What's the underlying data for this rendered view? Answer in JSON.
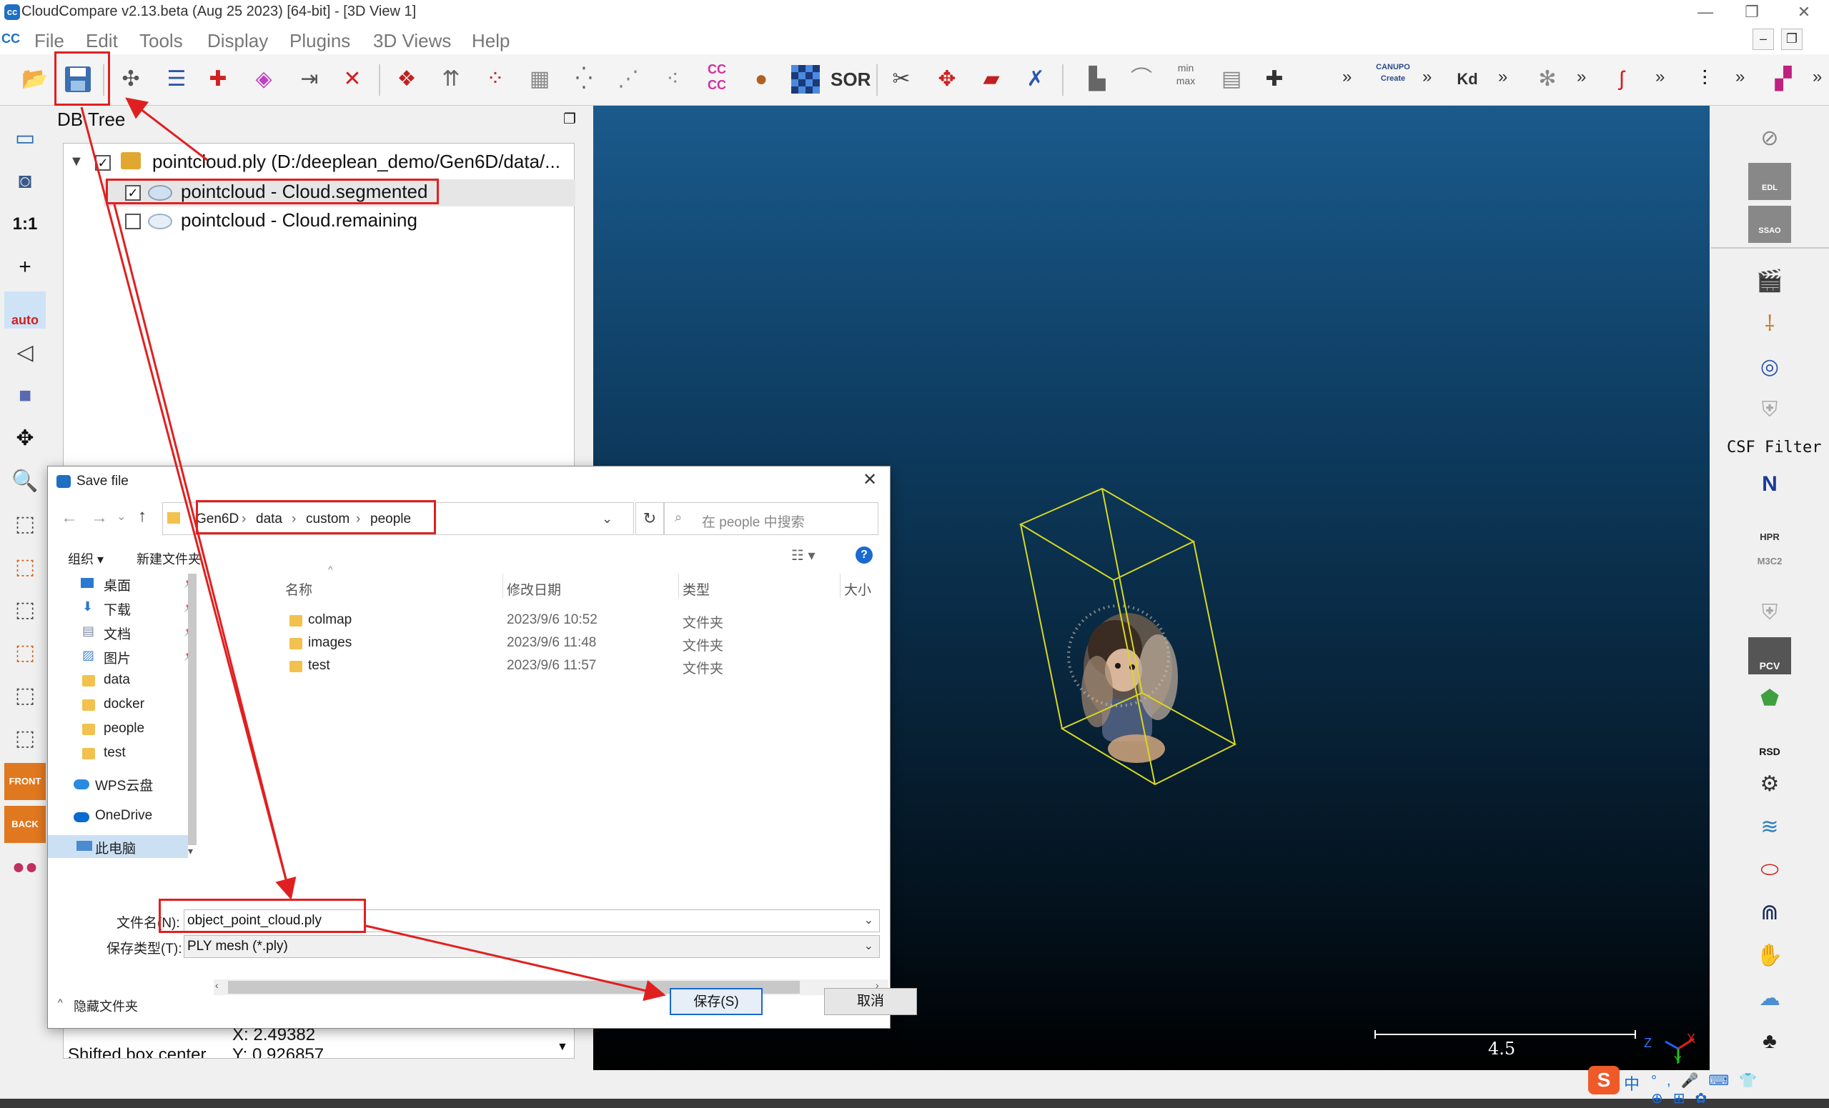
{
  "window": {
    "title": "CloudCompare v2.13.beta (Aug 25 2023) [64-bit] - [3D View 1]",
    "minimize": "—",
    "restore": "❐",
    "close": "✕",
    "mdi_min": "–",
    "mdi_restore": "❐"
  },
  "menu": [
    "File",
    "Edit",
    "Tools",
    "Display",
    "Plugins",
    "3D Views",
    "Help"
  ],
  "toolbar": {
    "icons": [
      "open-icon",
      "save-icon",
      "sample-icon",
      "list-icon",
      "crosshair-icon",
      "color-icon",
      "translate-icon",
      "delete-icon",
      "merge-icon",
      "normals-icon",
      "sample-points-icon",
      "mesh-icon",
      "subsample-icon",
      "scatter-icon",
      "scatter2-icon",
      "scatter3-icon"
    ],
    "cc_label": "CC\nCC",
    "sor_label": "SOR",
    "canupo_label": "CANUPO\nCreate",
    "kd_label": "Kd",
    "minmax_label": "min\nmax"
  },
  "left_tools": {
    "scale_label": "1:1",
    "auto_label": "auto",
    "front_label": "FRONT",
    "back_label": "BACK"
  },
  "db_tree": {
    "title": "DB Tree",
    "root": {
      "label": "pointcloud.ply (D:/deeplean_demo/Gen6D/data/...",
      "checked": true
    },
    "children": [
      {
        "label": "pointcloud - Cloud.segmented",
        "checked": true,
        "selected": true
      },
      {
        "label": "pointcloud - Cloud.remaining",
        "checked": false,
        "selected": false
      }
    ],
    "props": {
      "x_label": "X: 2.49382",
      "shifted_label": "Shifted box center",
      "y_label": "Y: 0.926857"
    }
  },
  "right_tools": {
    "edl_label": "EDL",
    "ssao_label": "SSAO",
    "csf_label": "CSF Filter",
    "north_label": "N",
    "hpr_label": "HPR",
    "m3c2_label": "M3C2",
    "pcv_label": "PCV",
    "rsd_label": "RSD"
  },
  "view3d": {
    "scale_value": "4.5",
    "axis_x": "X",
    "axis_y": "Y",
    "axis_z": "Z"
  },
  "dialog": {
    "title": "Save file",
    "breadcrumb": [
      "Gen6D",
      "data",
      "custom",
      "people"
    ],
    "search_placeholder": "在 people 中搜索",
    "organize": "组织 ▾",
    "new_folder": "新建文件夹",
    "nav": [
      {
        "label": "桌面",
        "pinned": true
      },
      {
        "label": "下载",
        "pinned": true
      },
      {
        "label": "文档",
        "pinned": true
      },
      {
        "label": "图片",
        "pinned": true
      },
      {
        "label": "data",
        "pinned": false
      },
      {
        "label": "docker",
        "pinned": false
      },
      {
        "label": "people",
        "pinned": false
      },
      {
        "label": "test",
        "pinned": false
      },
      {
        "label": "WPS云盘",
        "pinned": false
      },
      {
        "label": "OneDrive",
        "pinned": false
      },
      {
        "label": "此电脑",
        "pinned": false
      }
    ],
    "columns": [
      "名称",
      "修改日期",
      "类型",
      "大小"
    ],
    "files": [
      {
        "name": "colmap",
        "date": "2023/9/6 10:52",
        "type": "文件夹"
      },
      {
        "name": "images",
        "date": "2023/9/6 11:48",
        "type": "文件夹"
      },
      {
        "name": "test",
        "date": "2023/9/6 11:57",
        "type": "文件夹"
      }
    ],
    "filename_label": "文件名(N):",
    "filename_value": "object_point_cloud.ply",
    "filetype_label": "保存类型(T):",
    "filetype_value": "PLY mesh (*.ply)",
    "hide_folders": "隐藏文件夹",
    "save_button": "保存(S)",
    "cancel_button": "取消"
  },
  "annotation_color": "#e02020",
  "taskbar": {
    "ime_label": "中"
  }
}
